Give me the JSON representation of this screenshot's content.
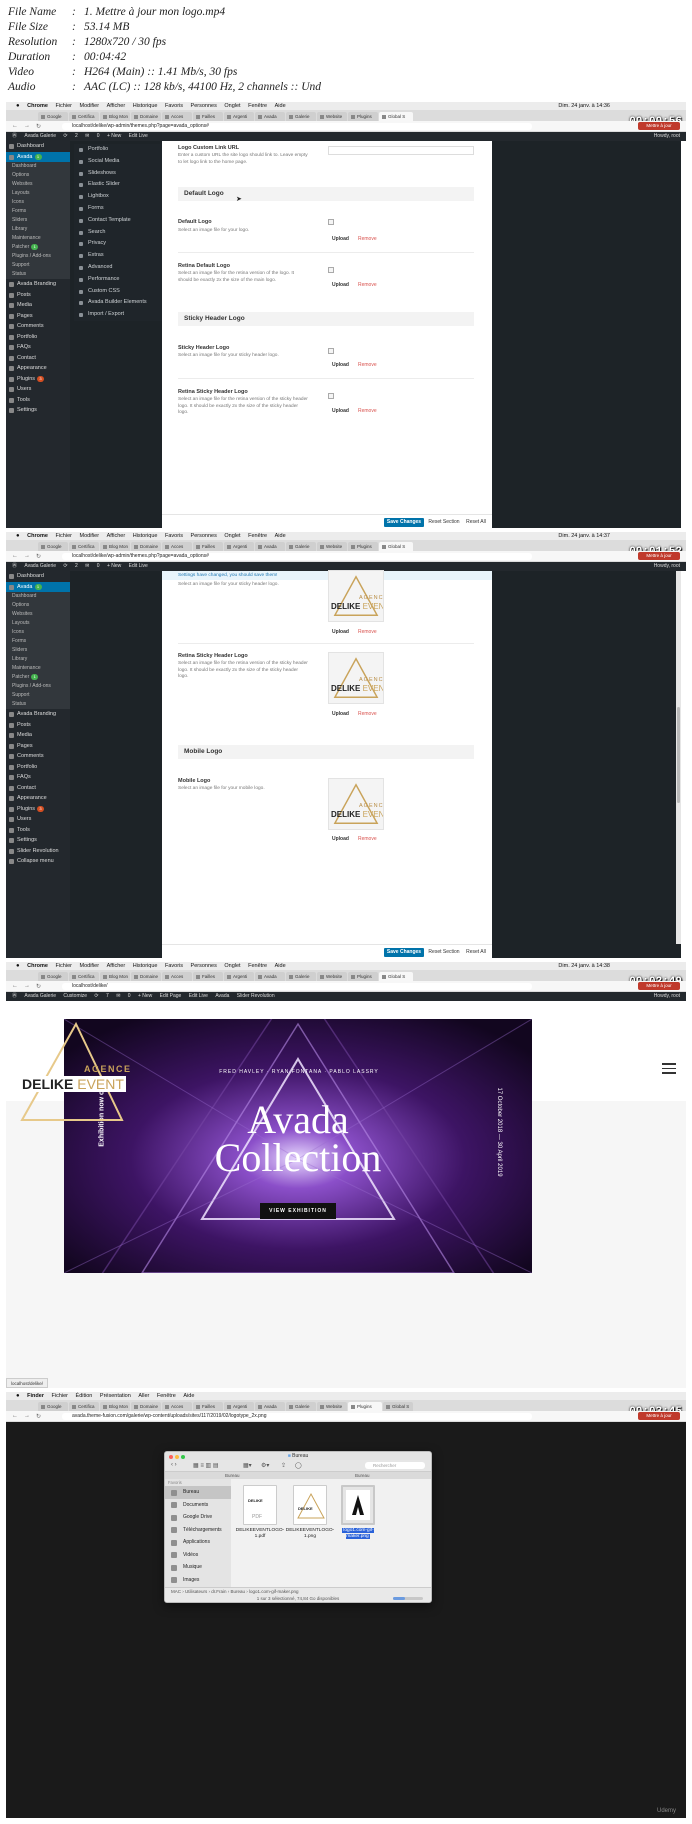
{
  "file_info": [
    {
      "key": "File Name",
      "value": "1. Mettre à jour mon logo.mp4"
    },
    {
      "key": "File Size",
      "value": "53.14 MB"
    },
    {
      "key": "Resolution",
      "value": "1280x720 / 30 fps"
    },
    {
      "key": "Duration",
      "value": "00:04:42"
    },
    {
      "key": "Video",
      "value": "H264 (Main) :: 1.41 Mb/s, 30 fps"
    },
    {
      "key": "Audio",
      "value": "AAC (LC) :: 128 kb/s, 44100 Hz, 2 channels :: Und"
    }
  ],
  "colors": {
    "wp_dark": "#23282d",
    "wp_blue": "#0073aa",
    "update_red": "#c0392b",
    "gold": "#c9a35a",
    "hero_purple": "#4a1f7a"
  },
  "chrome_menu": [
    "Chrome",
    "Fichier",
    "Modifier",
    "Afficher",
    "Historique",
    "Favoris",
    "Personnes",
    "Onglet",
    "Fenêtre",
    "Aide"
  ],
  "finder_menu": [
    "Finder",
    "Fichier",
    "Édition",
    "Présentation",
    "Aller",
    "Fenêtre",
    "Aide"
  ],
  "frame1": {
    "timestamp": "00:00:56",
    "clock": "Dim. 24 janv. à 14:36",
    "tabs": [
      "Google",
      "Certifica",
      "Blog Mon",
      "Domaine",
      "Acces",
      "Failles",
      "Argenti",
      "Avada",
      "Galerie",
      "Website",
      "Plugins",
      "Global S"
    ],
    "url": "localhost/delike/wp-admin/themes.php?page=avada_options#",
    "update_btn": "Mettre à jour",
    "adminbar": [
      "Avada Galerie",
      "2",
      "0",
      "+ New",
      "Edit Live"
    ],
    "howdy": "Howdy, root",
    "sidebar": [
      {
        "label": "Dashboard",
        "type": "item"
      },
      {
        "label": "Avada",
        "type": "active",
        "badge": "1"
      },
      {
        "label": "Dashboard",
        "type": "sub"
      },
      {
        "label": "Options",
        "type": "sub"
      },
      {
        "label": "Websites",
        "type": "sub"
      },
      {
        "label": "Layouts",
        "type": "sub"
      },
      {
        "label": "Icons",
        "type": "sub"
      },
      {
        "label": "Forms",
        "type": "sub"
      },
      {
        "label": "Sliders",
        "type": "sub"
      },
      {
        "label": "Library",
        "type": "sub"
      },
      {
        "label": "Maintenance",
        "type": "sub"
      },
      {
        "label": "Patcher",
        "type": "sub",
        "badge": "1"
      },
      {
        "label": "Plugins / Add-ons",
        "type": "sub"
      },
      {
        "label": "Support",
        "type": "sub"
      },
      {
        "label": "Status",
        "type": "sub"
      },
      {
        "label": "Avada Branding",
        "type": "item"
      },
      {
        "label": "Posts",
        "type": "item"
      },
      {
        "label": "Media",
        "type": "item"
      },
      {
        "label": "Pages",
        "type": "item"
      },
      {
        "label": "Comments",
        "type": "item"
      },
      {
        "label": "Portfolio",
        "type": "item"
      },
      {
        "label": "FAQs",
        "type": "item"
      },
      {
        "label": "Contact",
        "type": "item"
      },
      {
        "label": "Appearance",
        "type": "item"
      },
      {
        "label": "Plugins",
        "type": "item",
        "badge": "3"
      },
      {
        "label": "Users",
        "type": "item"
      },
      {
        "label": "Tools",
        "type": "item"
      },
      {
        "label": "Settings",
        "type": "item"
      }
    ],
    "avada_menu": [
      "Portfolio",
      "Social Media",
      "Slideshows",
      "Elastic Slider",
      "Lightbox",
      "Forms",
      "Contact Template",
      "Search",
      "Privacy",
      "Extras",
      "Advanced",
      "Performance",
      "Custom CSS",
      "Avada Builder Elements",
      "Import / Export"
    ],
    "custom_link_label": "Logo Custom Link URL",
    "custom_link_desc": "Enter a custom URL the site logo should link to. Leave empty to let logo link to the home page.",
    "section1": "Default Logo",
    "default_logo_label": "Default Logo",
    "default_logo_desc": "Select an image file for your logo.",
    "retina_label": "Retina Default Logo",
    "retina_desc": "Select an image file for the retina version of the logo. It should be exactly 2x the size of the main logo.",
    "section2": "Sticky Header Logo",
    "sticky_label": "Sticky Header Logo",
    "sticky_desc": "Select an image file for your sticky header logo.",
    "retina_sticky_label": "Retina Sticky Header Logo",
    "retina_sticky_desc": "Select an image file for the retina version of the sticky header logo. It should be exactly 2x the size of the sticky header logo.",
    "upload": "Upload",
    "remove": "Remove",
    "save": "Save Changes",
    "reset_section": "Reset Section",
    "reset_all": "Reset All"
  },
  "frame2": {
    "timestamp": "00:01:52",
    "clock": "Dim. 24 janv. à 14:37",
    "url": "localhost/delike/wp-admin/themes.php?page=avada_options#",
    "notice": "Settings have changed, you should save them!",
    "sticky_desc": "Select an image file for your sticky header logo.",
    "retina_sticky_label": "Retina Sticky Header Logo",
    "retina_sticky_desc": "Select an image file for the retina version of the sticky header logo. It should be exactly 2x the size of the sticky header logo.",
    "mobile_section": "Mobile Logo",
    "mobile_label": "Mobile Logo",
    "mobile_desc": "Select an image file for your mobile logo.",
    "logo_top": "AGENCE",
    "logo_a": "DELIKE",
    "logo_b": "EVENT",
    "sidebar_extra": [
      "Slider Revolution",
      "Collapse menu"
    ]
  },
  "frame3": {
    "timestamp": "00:02:49",
    "clock": "Dim. 24 janv. à 14:38",
    "url": "localhost/delike/",
    "adminbar": [
      "Avada Galerie",
      "Customize",
      "7",
      "0",
      "+ New",
      "Edit Page",
      "Edit Live",
      "Avada",
      "Slider Revolution"
    ],
    "artists": "FRED HAVLEY · RYAN FONTANA · PABLO LASSRY",
    "title1": "Avada",
    "title2": "Collection",
    "button": "VIEW EXHIBITION",
    "side_left": "Exhibition now open",
    "side_right": "17 October 2018 — 30 April 2019",
    "status_url": "localhost/delike/"
  },
  "frame4": {
    "timestamp": "00:03:45",
    "url": "avada.theme-fusion.com/galerie/wp-content/uploads/sites/117/2019/02/logotype_2x.png",
    "window_title": "Bureau",
    "search": "Rechercher",
    "col_left": "Bureau",
    "col_right": "Bureau",
    "sidebar_group": "Favoris",
    "sidebar": [
      "Bureau",
      "Documents",
      "Google Drive",
      "Téléchargements",
      "Applications",
      "Vidéos",
      "Musique",
      "Images"
    ],
    "sidebar_group2": "Emplacements",
    "files": [
      "DELIKEEVENTLOGO-1.pdf",
      "DELIKEEVENTLOGO-1.png",
      "logo1.com-gif-maker.png"
    ],
    "pdf_tag": "PDF",
    "path": "MAC › Utilisateurs › dr.Frain › Bureau › logo1.com-gif-maker.png",
    "status": "1 sur 3 sélectionné, 74,84 Go disponibles"
  },
  "watermark": "Udemy"
}
